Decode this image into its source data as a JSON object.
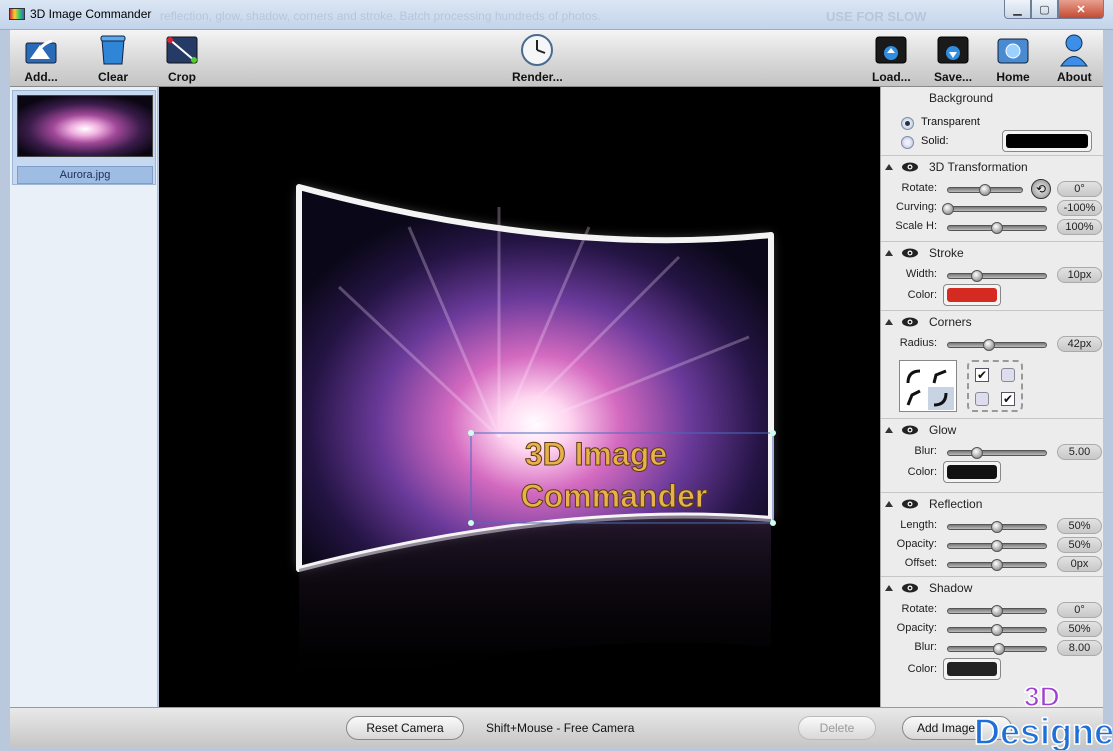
{
  "window": {
    "title": "3D Image Commander",
    "ghost_text": "reflection, glow, shadow, corners and stroke. Batch processing hundreds of photos.",
    "ghost_text_right": "USE FOR SLOW"
  },
  "toolbar": {
    "add": "Add...",
    "clear": "Clear",
    "crop": "Crop",
    "render": "Render...",
    "load": "Load...",
    "save": "Save...",
    "home": "Home",
    "about": "About"
  },
  "left_panel": {
    "items": [
      {
        "filename": "Aurora.jpg"
      }
    ]
  },
  "canvas": {
    "overlay_line1": "3D Image",
    "overlay_line2": "Commander"
  },
  "right_panel": {
    "background": {
      "title": "Background",
      "transparent_label": "Transparent",
      "solid_label": "Solid:",
      "selected": "Transparent",
      "solid_color": "#000000"
    },
    "transformation": {
      "title": "3D Transformation",
      "rotate_label": "Rotate:",
      "rotate_value": "0°",
      "rotate_pos": 0.5,
      "curving_label": "Curving:",
      "curving_value": "-100%",
      "curving_pos": 0.0,
      "scaleh_label": "Scale H:",
      "scaleh_value": "100%",
      "scaleh_pos": 0.5
    },
    "stroke": {
      "title": "Stroke",
      "width_label": "Width:",
      "width_value": "10px",
      "width_pos": 0.3,
      "color_label": "Color:",
      "color": "#d42a22"
    },
    "corners": {
      "title": "Corners",
      "radius_label": "Radius:",
      "radius_value": "42px",
      "radius_pos": 0.42
    },
    "glow": {
      "title": "Glow",
      "blur_label": "Blur:",
      "blur_value": "5.00",
      "blur_pos": 0.3,
      "color_label": "Color:",
      "color": "#111111"
    },
    "reflection": {
      "title": "Reflection",
      "length_label": "Length:",
      "length_value": "50%",
      "length_pos": 0.5,
      "opacity_label": "Opacity:",
      "opacity_value": "50%",
      "opacity_pos": 0.5,
      "offset_label": "Offset:",
      "offset_value": "0px",
      "offset_pos": 0.5
    },
    "shadow": {
      "title": "Shadow",
      "rotate_label": "Rotate:",
      "rotate_value": "0°",
      "rotate_pos": 0.5,
      "opacity_label": "Opacity:",
      "opacity_value": "50%",
      "opacity_pos": 0.5,
      "blur_label": "Blur:",
      "blur_value": "8.00",
      "blur_pos": 0.52,
      "color_label": "Color:",
      "color": "#222222"
    }
  },
  "bottom_bar": {
    "reset_camera": "Reset Camera",
    "hint": "Shift+Mouse - Free Camera",
    "delete": "Delete",
    "add_image": "Add Image"
  },
  "watermark": {
    "top": "3D",
    "bottom": "Designer"
  }
}
